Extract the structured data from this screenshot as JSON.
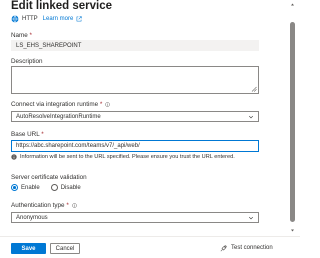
{
  "header": {
    "title": "Edit linked service",
    "protocol": "HTTP",
    "learn_more": "Learn more"
  },
  "form": {
    "name": {
      "label": "Name",
      "required_mark": "*",
      "value": "LS_EHS_SHAREPOINT"
    },
    "description": {
      "label": "Description",
      "value": ""
    },
    "integration_runtime": {
      "label": "Connect via integration runtime",
      "required_mark": "*",
      "value": "AutoResolveIntegrationRuntime"
    },
    "base_url": {
      "label": "Base URL",
      "required_mark": "*",
      "value": "https://abc.sharepoint.com/teams/v7/_api/web/",
      "info": "Information will be sent to the URL specified. Please ensure you trust the URL entered."
    },
    "server_cert": {
      "label": "Server certificate validation",
      "options": [
        "Enable",
        "Disable"
      ],
      "selected": "Enable"
    },
    "auth_type": {
      "label": "Authentication type",
      "required_mark": "*",
      "value": "Anonymous"
    }
  },
  "footer": {
    "save": "Save",
    "cancel": "Cancel",
    "test_connection": "Test connection"
  },
  "colors": {
    "accent": "#0078d4",
    "required": "#a4262c"
  },
  "icons": [
    "http-icon",
    "external-link-icon",
    "info-icon",
    "chevron-down-icon",
    "plug-icon"
  ]
}
